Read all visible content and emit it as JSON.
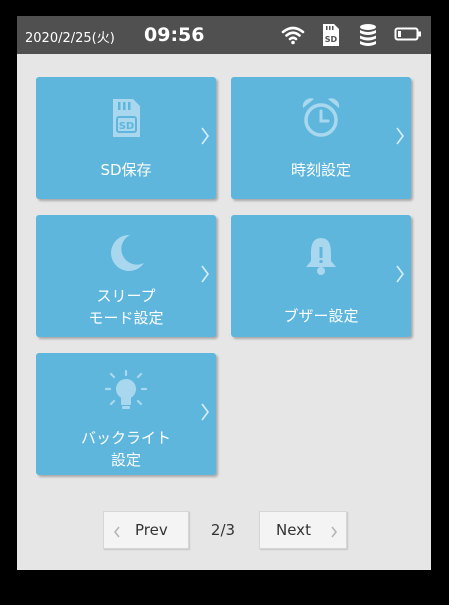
{
  "status_bar": {
    "date": "2020/2/25(火)",
    "time": "09:56",
    "icons": [
      "wifi-icon",
      "sd-card-icon",
      "database-icon",
      "battery-icon"
    ],
    "sd_label": "SD"
  },
  "menu": {
    "tiles": [
      {
        "label": "SD保存",
        "icon": "sd-card-icon",
        "icon_text": "SD"
      },
      {
        "label": "時刻設定",
        "icon": "alarm-clock-icon"
      },
      {
        "label": "スリープ\nモード設定",
        "icon": "moon-icon"
      },
      {
        "label": "ブザー設定",
        "icon": "bell-icon"
      },
      {
        "label": "バックライト\n設定",
        "icon": "light-bulb-icon"
      }
    ]
  },
  "pagination": {
    "prev_label": "Prev",
    "next_label": "Next",
    "indicator": "2/3"
  },
  "colors": {
    "tile_background": "#5fb6dc",
    "tile_icon": "#a9d8ee",
    "status_bar": "#505050",
    "screen_background": "#e6e6e6"
  }
}
